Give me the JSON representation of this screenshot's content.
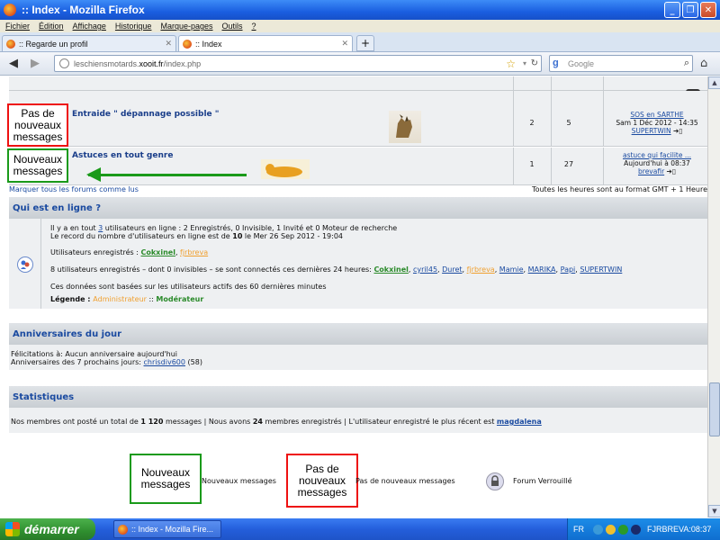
{
  "window": {
    "title": ":: Index - Mozilla Firefox",
    "buttons": [
      "_",
      "❐",
      "✕"
    ]
  },
  "menubar": [
    "Fichier",
    "Édition",
    "Affichage",
    "Historique",
    "Marque-pages",
    "Outils",
    "?"
  ],
  "tabs": [
    {
      "label": ":: Regarde un profil",
      "active": false
    },
    {
      "label": ":: Index",
      "active": true
    }
  ],
  "navbar": {
    "url_prefix": "leschiensmotards.",
    "url_domain": "xooit.fr",
    "url_suffix": "/index.php",
    "search_placeholder": "Google"
  },
  "top_partial_label": "messages",
  "forums": [
    {
      "status_label": "Pas de nouveaux messages",
      "status_color": "#ee1111",
      "title": "Entraide \" dépannage possible \"",
      "topics": "2",
      "posts": "5",
      "last_post_title": "SOS en SARTHE",
      "last_post_date": "Sam 1 Déc 2012 - 14:35",
      "last_post_user": "SUPERTWIN"
    },
    {
      "status_label": "Nouveaux messages",
      "status_color": "#1a9a1a",
      "title": "Astuces en tout genre",
      "topics": "1",
      "posts": "27",
      "last_post_title": "astuce qui facilite ...",
      "last_post_date": "Aujourd'hui à 08:37",
      "last_post_user": "brevafir"
    }
  ],
  "mark_all_read": "Marquer tous les forums comme lus",
  "timezone_note": "Toutes les heures sont au format GMT + 1 Heure",
  "whos_online": {
    "header": "Qui est en ligne ?",
    "line1_pre": "Il y a en tout ",
    "line1_count": "3",
    "line1_post": " utilisateurs en ligne : 2 Enregistrés, 0 Invisible, 1 Invité et 0 Moteur de recherche",
    "line2_pre": "Le record du nombre d'utilisateurs en ligne est de ",
    "line2_count": "10",
    "line2_post": " le Mer 26 Sep 2012 - 19:04",
    "registered_label": "Utilisateurs enregistrés : ",
    "registered_users": [
      "Cokxinel",
      "fjrbreva"
    ],
    "last24_label": "8 utilisateurs enregistrés – dont 0 invisibles – se sont connectés ces dernières 24 heures: ",
    "last24_users": [
      "Cokxinel",
      "cyril45",
      "Duret",
      "fjrbreva",
      "Mamie",
      "MARIKA",
      "Papi",
      "SUPERTWIN"
    ],
    "active_note": "Ces données sont basées sur les utilisateurs actifs des 60 dernières minutes",
    "legend_label": "Légende : ",
    "legend_admin": "Administrateur",
    "legend_sep": " :: ",
    "legend_modo": "Modérateur"
  },
  "birthdays": {
    "header": "Anniversaires du jour",
    "today": "Félicitations à: Aucun anniversaire aujourd'hui",
    "upcoming_label": "Anniversaires des 7 prochains jours: ",
    "upcoming_user": "chrisdiv600",
    "upcoming_age": " (58)"
  },
  "stats": {
    "header": "Statistiques",
    "p1": "Nos membres ont posté un total de ",
    "total_posts": "1 120",
    "p2": " messages | Nous avons ",
    "total_members": "24",
    "p3": " membres enregistrés | L'utilisateur enregistré le plus récent est ",
    "newest_member": "magdalena"
  },
  "legend_bottom": {
    "new_box": "Nouveaux messages",
    "new_label": "Nouveaux messages",
    "nonew_box": "Pas de nouveaux messages",
    "nonew_label": "Pas de nouveaux messages",
    "locked_label": "Forum Verrouillé"
  },
  "taskbar": {
    "start": "démarrer",
    "task": ":: Index - Mozilla Fire...",
    "lang": "FR",
    "clock": "FJRBREVA:08:37"
  }
}
